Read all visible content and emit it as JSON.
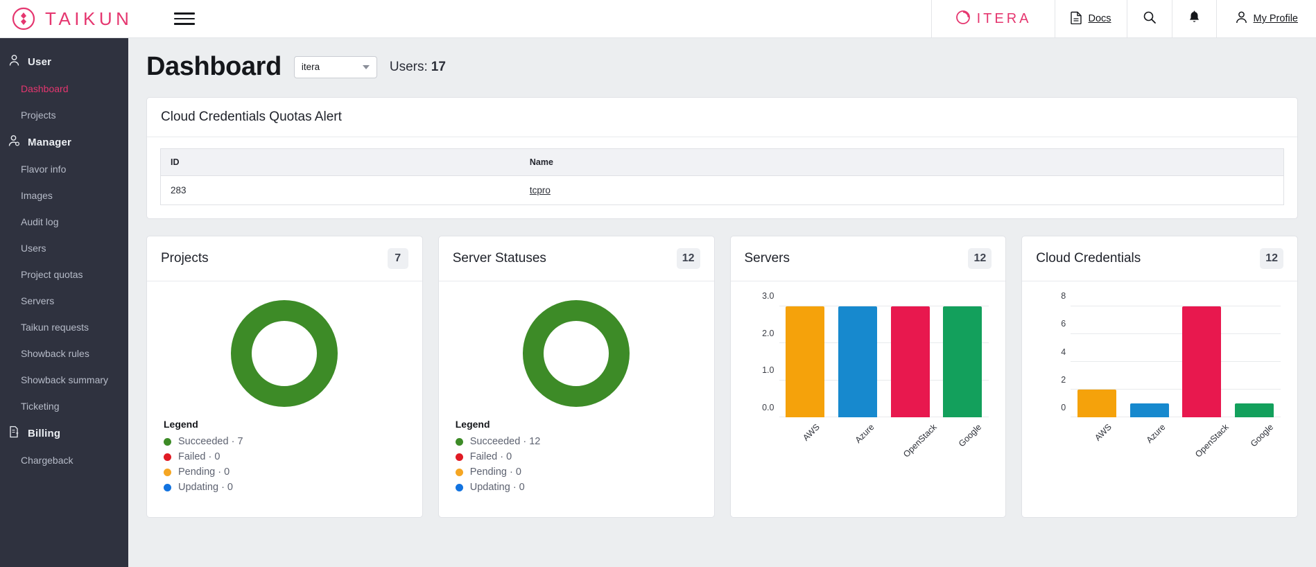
{
  "topbar": {
    "brand": "TAIKUN",
    "brand_icon": "taikun-diamond-logo",
    "menu_icon": "hamburger-menu-icon",
    "org_logo": "ITERA",
    "docs_label": "Docs",
    "docs_icon": "document-icon",
    "search_icon": "search-icon",
    "notifications_icon": "bell-icon",
    "profile_label": "My Profile",
    "profile_icon": "person-icon"
  },
  "sidebar": {
    "groups": [
      {
        "label": "User",
        "icon": "person-icon",
        "items": [
          {
            "label": "Dashboard",
            "active": true
          },
          {
            "label": "Projects",
            "active": false
          }
        ]
      },
      {
        "label": "Manager",
        "icon": "person-gear-icon",
        "items": [
          {
            "label": "Flavor info",
            "active": false
          },
          {
            "label": "Images",
            "active": false
          },
          {
            "label": "Audit log",
            "active": false
          },
          {
            "label": "Users",
            "active": false
          },
          {
            "label": "Project quotas",
            "active": false
          },
          {
            "label": "Servers",
            "active": false
          },
          {
            "label": "Taikun requests",
            "active": false
          },
          {
            "label": "Showback rules",
            "active": false
          },
          {
            "label": "Showback summary",
            "active": false
          },
          {
            "label": "Ticketing",
            "active": false
          }
        ]
      },
      {
        "label": "Billing",
        "icon": "invoice-dollar-icon",
        "items": [
          {
            "label": "Chargeback",
            "active": false
          }
        ]
      }
    ]
  },
  "page": {
    "title": "Dashboard",
    "org_select_value": "itera",
    "users_label": "Users:",
    "users_count": "17"
  },
  "alert_card": {
    "title": "Cloud Credentials Quotas Alert",
    "columns": [
      "ID",
      "Name"
    ],
    "rows": [
      {
        "id": "283",
        "name": "tcpro"
      }
    ]
  },
  "colors": {
    "succeeded": "#3d8b27",
    "failed": "#e01b24",
    "pending": "#f5a623",
    "updating": "#1273e0",
    "aws": "#f5a20b",
    "azure": "#1789ce",
    "openstack": "#e8184e",
    "google": "#13a05c",
    "accent": "#e5366f"
  },
  "chart_data": [
    {
      "type": "pie",
      "title": "Projects",
      "badge": "7",
      "legend_title": "Legend",
      "legend_position": "bottom-left",
      "categories": [
        "Succeeded",
        "Failed",
        "Pending",
        "Updating"
      ],
      "values": [
        7,
        0,
        0,
        0
      ],
      "colors": [
        "#3d8b27",
        "#e01b24",
        "#f5a623",
        "#1273e0"
      ],
      "labels": [
        "Succeeded · 7",
        "Failed · 0",
        "Pending · 0",
        "Updating · 0"
      ]
    },
    {
      "type": "pie",
      "title": "Server Statuses",
      "badge": "12",
      "legend_title": "Legend",
      "legend_position": "bottom-left",
      "categories": [
        "Succeeded",
        "Failed",
        "Pending",
        "Updating"
      ],
      "values": [
        12,
        0,
        0,
        0
      ],
      "colors": [
        "#3d8b27",
        "#e01b24",
        "#f5a623",
        "#1273e0"
      ],
      "labels": [
        "Succeeded · 12",
        "Failed · 0",
        "Pending · 0",
        "Updating · 0"
      ]
    },
    {
      "type": "bar",
      "title": "Servers",
      "badge": "12",
      "categories": [
        "AWS",
        "Azure",
        "OpenStack",
        "Google"
      ],
      "values": [
        3,
        3,
        3,
        3
      ],
      "colors": [
        "#f5a20b",
        "#1789ce",
        "#e8184e",
        "#13a05c"
      ],
      "yticks": [
        "0.0",
        "1.0",
        "2.0",
        "3.0"
      ],
      "ytick_values": [
        0,
        1,
        2,
        3
      ],
      "ylim": [
        0,
        3
      ],
      "xlabel": "",
      "ylabel": "",
      "grid": true
    },
    {
      "type": "bar",
      "title": "Cloud Credentials",
      "badge": "12",
      "categories": [
        "AWS",
        "Azure",
        "OpenStack",
        "Google"
      ],
      "values": [
        2,
        1,
        8,
        1
      ],
      "colors": [
        "#f5a20b",
        "#1789ce",
        "#e8184e",
        "#13a05c"
      ],
      "yticks": [
        "0",
        "2",
        "4",
        "6",
        "8"
      ],
      "ytick_values": [
        0,
        2,
        4,
        6,
        8
      ],
      "ylim": [
        0,
        8
      ],
      "xlabel": "",
      "ylabel": "",
      "grid": true
    }
  ]
}
